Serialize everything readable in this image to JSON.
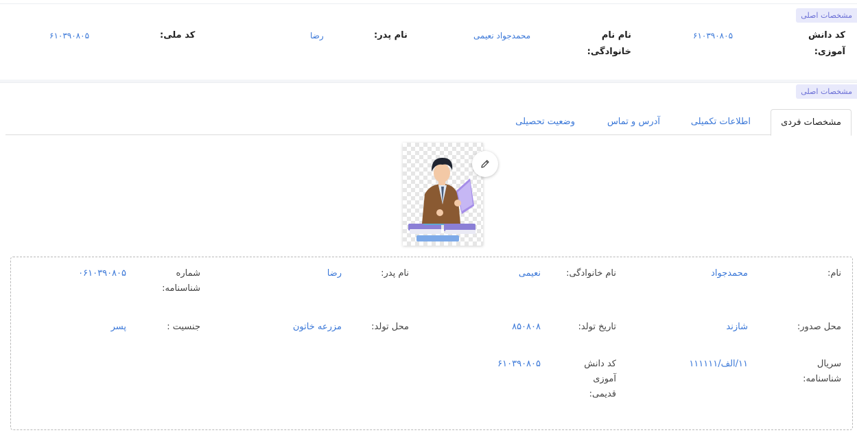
{
  "sections": {
    "top_tag": "مشخصات اصلی",
    "bottom_tag": "مشخصات اصلی"
  },
  "header": {
    "student_code_label": "کد دانش آموزی:",
    "student_code_value": "۶۱۰۳۹۰۸۰۵",
    "lastname_label": "نام نام خانوادگی:",
    "fullname_value": "محمدجواد  نعیمی",
    "father_label": "نام پدر:",
    "father_value": "رضا",
    "national_code_label": "کد ملی:",
    "national_code_value": "۶۱۰۳۹۰۸۰۵"
  },
  "tabs": [
    {
      "label": "مشخصات فردی",
      "active": true
    },
    {
      "label": "اطلاعات تکمیلی",
      "active": false
    },
    {
      "label": "آدرس و تماس",
      "active": false
    },
    {
      "label": "وضعیت تحصیلی",
      "active": false
    }
  ],
  "details": {
    "name_label": "نام:",
    "name_value": "محمدجواد",
    "lastname_label": "نام خانوادگی:",
    "lastname_value": "نعیمی",
    "father_label": "نام پدر:",
    "father_value": "رضا",
    "id_number_label": "شماره شناسنامه:",
    "id_number_value": "۰۶۱۰۳۹۰۸۰۵",
    "issue_place_label": "محل صدور:",
    "issue_place_value": "شازند",
    "birth_date_label": "تاریخ تولد:",
    "birth_date_value": "۸۵۰۸۰۸",
    "birth_place_label": "محل تولد:",
    "birth_place_value": "مزرعه خاتون",
    "gender_label": "جنسیت :",
    "gender_value": "پسر",
    "serial_label": "سریال شناسنامه:",
    "serial_value": "۱۱/الف/۱۱۱۱۱۱",
    "old_code_label": "کد دانش آموزی قدیمی:",
    "old_code_value": "۶۱۰۳۹۰۸۰۵"
  },
  "colors": {
    "accent": "#3b78d8",
    "tag_bg": "#e8e9fb",
    "tag_text": "#6b6fd6"
  },
  "icons": {
    "edit": "pencil-icon",
    "photo": "student-avatar-illustration"
  }
}
